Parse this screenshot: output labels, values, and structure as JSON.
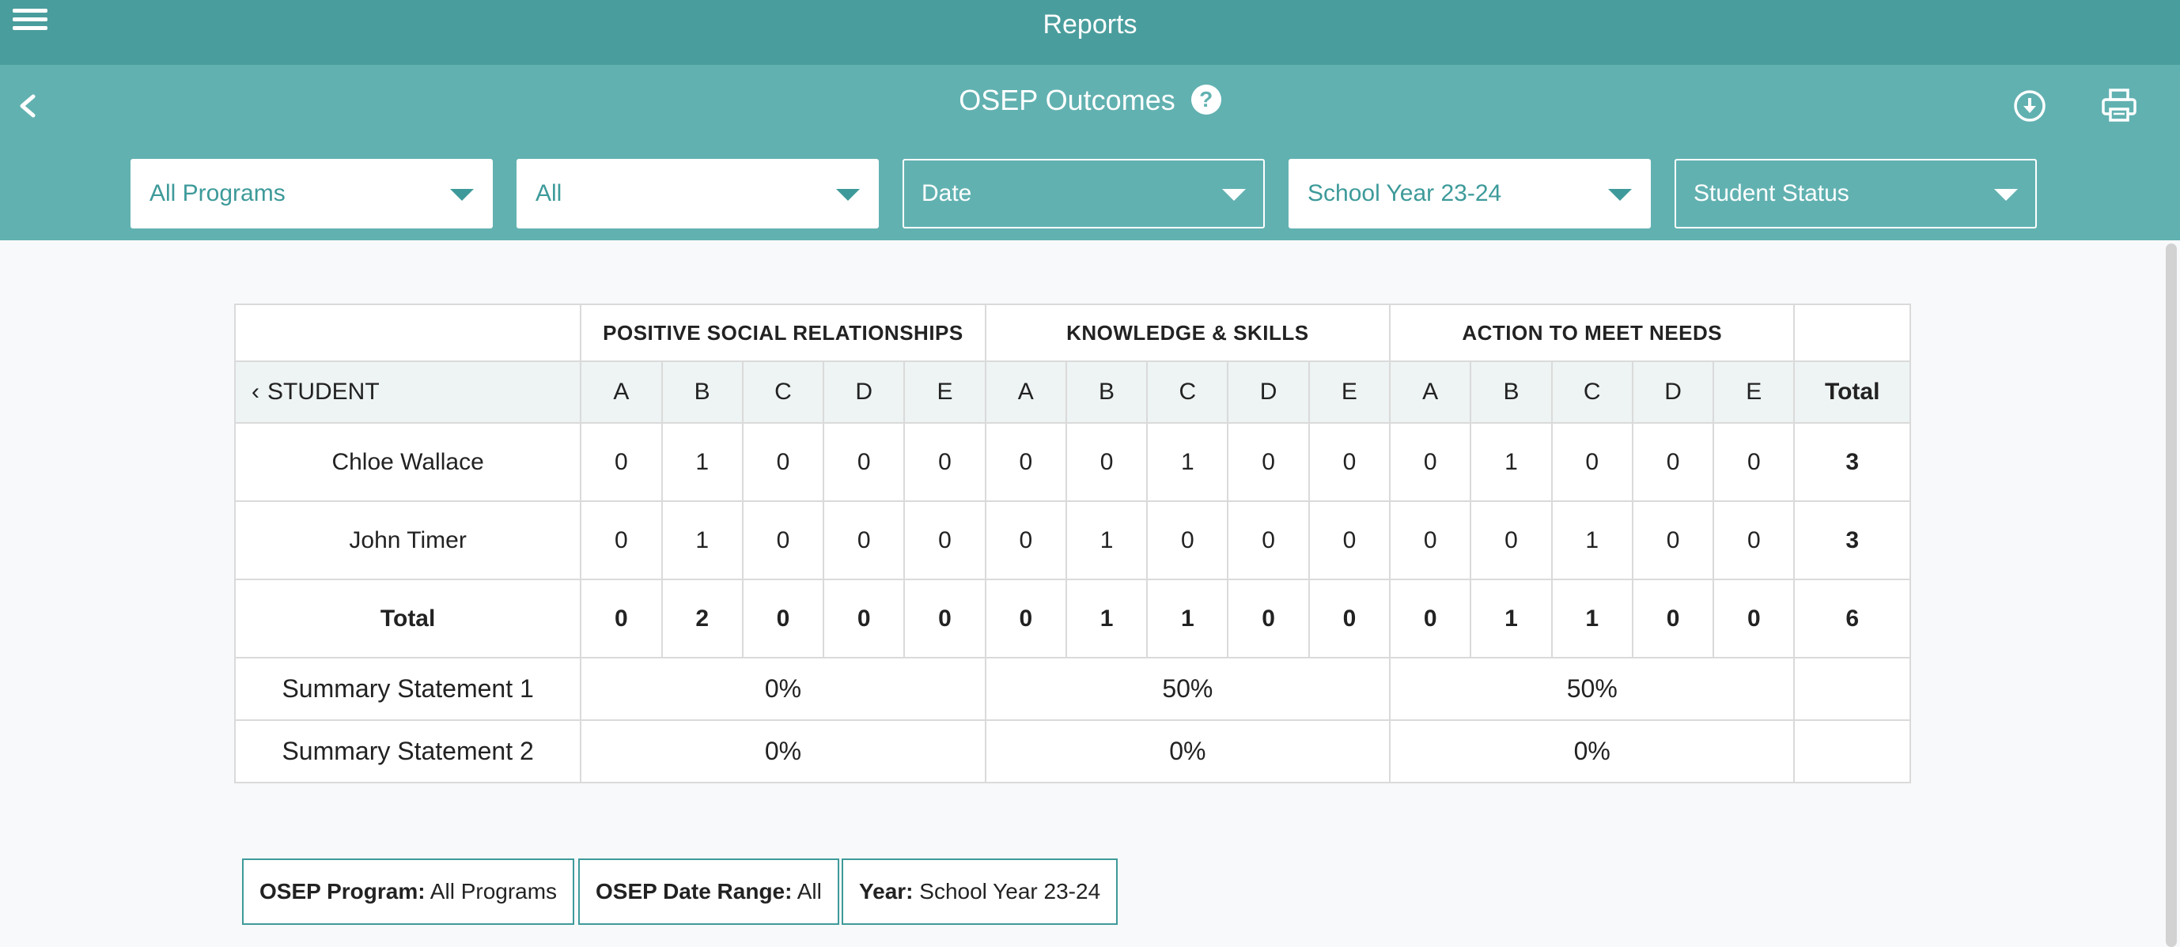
{
  "app": {
    "title": "Reports"
  },
  "header": {
    "title": "OSEP Outcomes",
    "help_symbol": "?"
  },
  "filters": [
    {
      "label": "All Programs",
      "style": "light"
    },
    {
      "label": "All",
      "style": "light"
    },
    {
      "label": "Date",
      "style": "dark"
    },
    {
      "label": "School Year 23-24",
      "style": "light"
    },
    {
      "label": "Student Status",
      "style": "dark"
    }
  ],
  "table": {
    "groups": [
      "POSITIVE SOCIAL RELATIONSHIPS",
      "KNOWLEDGE & SKILLS",
      "ACTION TO MEET NEEDS"
    ],
    "student_header": "STUDENT",
    "grades": [
      "A",
      "B",
      "C",
      "D",
      "E"
    ],
    "total_header": "Total",
    "rows": [
      {
        "name": "Chloe Wallace",
        "values": [
          "0",
          "1",
          "0",
          "0",
          "0",
          "0",
          "0",
          "1",
          "0",
          "0",
          "0",
          "1",
          "0",
          "0",
          "0"
        ],
        "total": "3"
      },
      {
        "name": "John Timer",
        "values": [
          "0",
          "1",
          "0",
          "0",
          "0",
          "0",
          "1",
          "0",
          "0",
          "0",
          "0",
          "0",
          "1",
          "0",
          "0"
        ],
        "total": "3"
      }
    ],
    "totals_row": {
      "label": "Total",
      "values": [
        "0",
        "2",
        "0",
        "0",
        "0",
        "0",
        "1",
        "1",
        "0",
        "0",
        "0",
        "1",
        "1",
        "0",
        "0"
      ],
      "total": "6"
    },
    "summaries": [
      {
        "label": "Summary Statement 1",
        "values": [
          "0%",
          "50%",
          "50%"
        ]
      },
      {
        "label": "Summary Statement 2",
        "values": [
          "0%",
          "0%",
          "0%"
        ]
      }
    ]
  },
  "chips": [
    {
      "key": "OSEP Program:",
      "value": "All Programs"
    },
    {
      "key": "OSEP Date Range:",
      "value": "All"
    },
    {
      "key": "Year:",
      "value": "School Year 23-24"
    }
  ],
  "colors": {
    "topbar": "#4a9d9d",
    "subbar": "#62b1b1",
    "accent": "#3e9a9a"
  }
}
